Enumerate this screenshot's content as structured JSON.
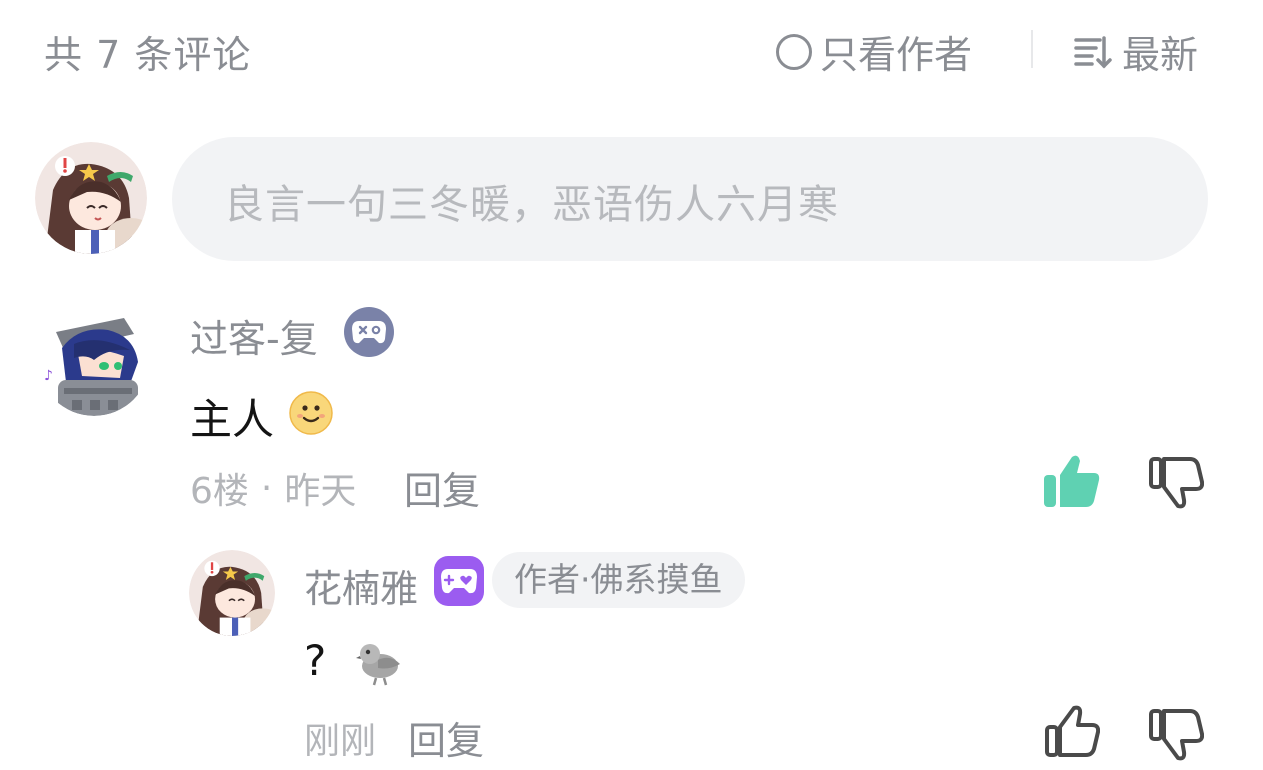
{
  "header": {
    "comment_count": "共 7 条评论",
    "author_only_label": "只看作者",
    "sort_label": "最新"
  },
  "composer": {
    "placeholder": "良言一句三冬暖，恶语伤人六月寒"
  },
  "comments": [
    {
      "username": "过客-复",
      "content": "主人",
      "floor": "6楼",
      "separator": "·",
      "time": "昨天",
      "reply_label": "回复",
      "liked": true,
      "badge_icon": "gamepad-icon",
      "reply": {
        "username": "花楠雅",
        "badge_icon": "heart-gamepad-icon",
        "tag": "作者·佛系摸鱼",
        "content": "?",
        "time": "刚刚",
        "reply_label": "回复",
        "liked": false
      }
    }
  ],
  "colors": {
    "like_active": "#5fd1b2",
    "icon_gray": "#4a4a4a",
    "badge_blue": "#7a82a8",
    "badge_purple": "#9b5cf0"
  }
}
